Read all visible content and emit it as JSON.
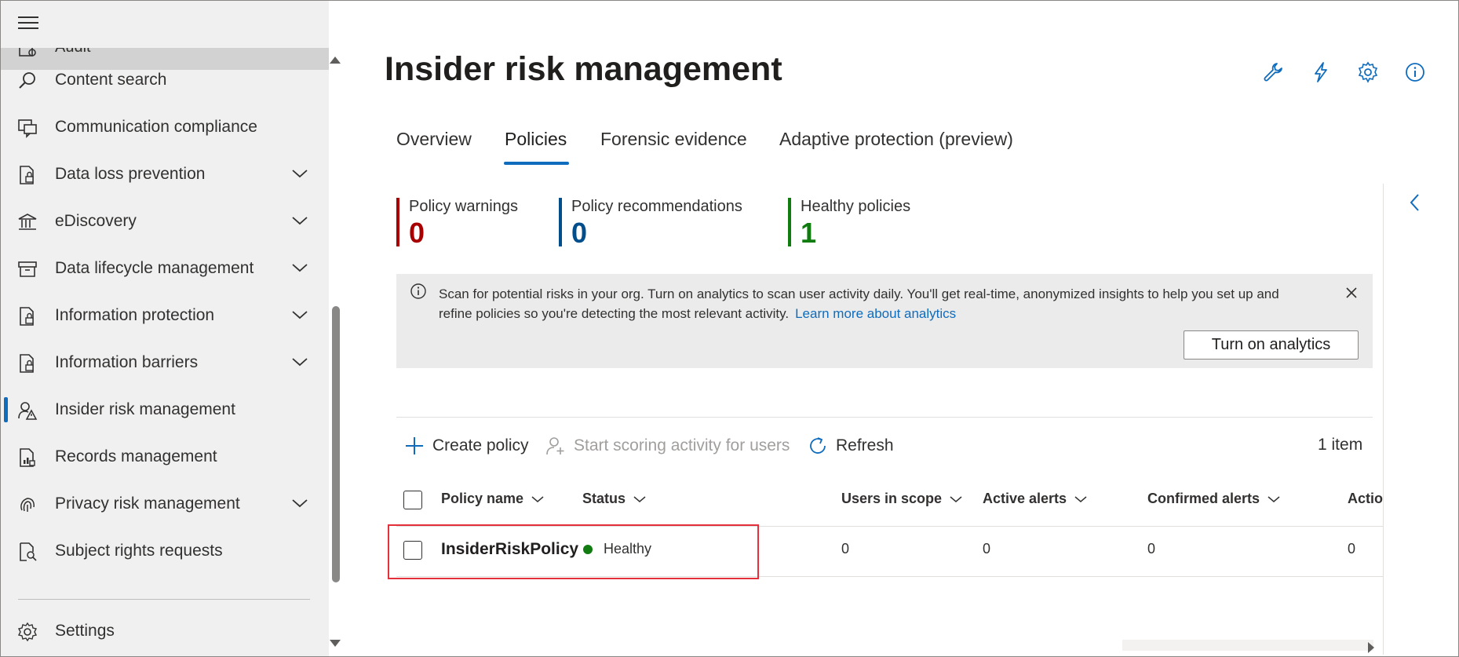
{
  "sidebar": {
    "partial_item": {
      "label": "Audit",
      "icon": "audit-icon"
    },
    "items": [
      {
        "label": "Content search",
        "icon": "search-icon",
        "expandable": false,
        "active": false
      },
      {
        "label": "Communication compliance",
        "icon": "chat-icon",
        "expandable": false,
        "active": false
      },
      {
        "label": "Data loss prevention",
        "icon": "document-lock-icon",
        "expandable": true,
        "active": false
      },
      {
        "label": "eDiscovery",
        "icon": "courthouse-icon",
        "expandable": true,
        "active": false
      },
      {
        "label": "Data lifecycle management",
        "icon": "archive-icon",
        "expandable": true,
        "active": false
      },
      {
        "label": "Information protection",
        "icon": "document-lock-icon",
        "expandable": true,
        "active": false
      },
      {
        "label": "Information barriers",
        "icon": "document-lock-icon",
        "expandable": true,
        "active": false
      },
      {
        "label": "Insider risk management",
        "icon": "person-warning-icon",
        "expandable": false,
        "active": true
      },
      {
        "label": "Records management",
        "icon": "document-chart-icon",
        "expandable": false,
        "active": false
      },
      {
        "label": "Privacy risk management",
        "icon": "fingerprint-icon",
        "expandable": true,
        "active": false
      },
      {
        "label": "Subject rights requests",
        "icon": "person-search-icon",
        "expandable": false,
        "active": false
      }
    ],
    "settings": {
      "label": "Settings",
      "icon": "gear-icon"
    }
  },
  "header": {
    "title": "Insider risk management",
    "icons": [
      "wrench-icon",
      "lightning-icon",
      "gear-icon",
      "info-icon"
    ]
  },
  "tabs": [
    {
      "label": "Overview",
      "active": false
    },
    {
      "label": "Policies",
      "active": true
    },
    {
      "label": "Forensic evidence",
      "active": false
    },
    {
      "label": "Adaptive protection (preview)",
      "active": false
    }
  ],
  "stats": [
    {
      "title": "Policy warnings",
      "value": "0",
      "color": "#a80000"
    },
    {
      "title": "Policy recommendations",
      "value": "0",
      "color": "#004e8c"
    },
    {
      "title": "Healthy policies",
      "value": "1",
      "color": "#107c10"
    }
  ],
  "banner": {
    "message": "Scan for potential risks in your org. Turn on analytics to scan user activity daily. You'll get real-time, anonymized insights to help you set up and refine policies so you're detecting the most relevant activity.",
    "link": "Learn more about analytics",
    "button": "Turn on analytics"
  },
  "commands": {
    "create": "Create policy",
    "scoring": "Start scoring activity for users",
    "refresh": "Refresh",
    "count": "1 item"
  },
  "table": {
    "columns": [
      "Policy name",
      "Status",
      "Users in scope",
      "Active alerts",
      "Confirmed alerts",
      "Actio"
    ],
    "rows": [
      {
        "name": "InsiderRiskPolicy",
        "status": "Healthy",
        "status_color": "#107c10",
        "users": "0",
        "active": "0",
        "confirmed": "0",
        "actions": "0"
      }
    ]
  },
  "colors": {
    "accent": "#0f6cbd",
    "highlight": "#e3303a"
  }
}
